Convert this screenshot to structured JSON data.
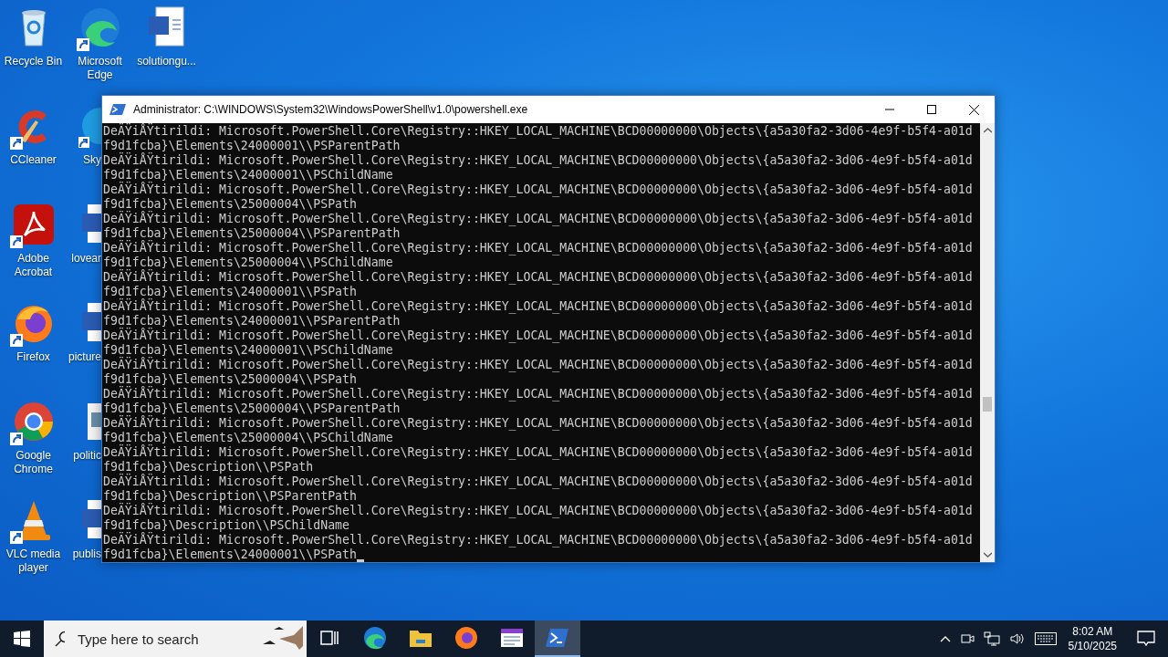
{
  "desktop": {
    "columns": [
      [
        {
          "label": "Recycle Bin",
          "shortcut": false
        },
        {
          "label": "CCleaner",
          "shortcut": true
        },
        {
          "label": "Adobe Acrobat",
          "shortcut": true
        },
        {
          "label": "Firefox",
          "shortcut": true
        },
        {
          "label": "Google Chrome",
          "shortcut": true
        },
        {
          "label": "VLC media player",
          "shortcut": true
        }
      ],
      [
        {
          "label": "Microsoft Edge",
          "shortcut": true
        },
        {
          "label": "Sky",
          "shortcut": true
        },
        {
          "label": "lovear",
          "shortcut": false
        },
        {
          "label": "picture",
          "shortcut": false
        },
        {
          "label": "politic",
          "shortcut": false
        },
        {
          "label": "publis",
          "shortcut": false
        }
      ],
      [
        {
          "label": "solutiongu...",
          "shortcut": false
        }
      ]
    ]
  },
  "window": {
    "title": "Administrator: C:\\WINDOWS\\System32\\WindowsPowerShell\\v1.0\\powershell.exe",
    "lines": [
      "DeÄŸiÅŸtirildi: Microsoft.PowerShell.Core\\Registry::HKEY_LOCAL_MACHINE\\BCD00000000\\Objects\\{a5a30fa2-3d06-4e9f-b5f4-a01d",
      "f9d1fcba}\\Elements\\24000001\\\\PSParentPath",
      "DeÄŸiÅŸtirildi: Microsoft.PowerShell.Core\\Registry::HKEY_LOCAL_MACHINE\\BCD00000000\\Objects\\{a5a30fa2-3d06-4e9f-b5f4-a01d",
      "f9d1fcba}\\Elements\\24000001\\\\PSChildName",
      "DeÄŸiÅŸtirildi: Microsoft.PowerShell.Core\\Registry::HKEY_LOCAL_MACHINE\\BCD00000000\\Objects\\{a5a30fa2-3d06-4e9f-b5f4-a01d",
      "f9d1fcba}\\Elements\\25000004\\\\PSPath",
      "DeÄŸiÅŸtirildi: Microsoft.PowerShell.Core\\Registry::HKEY_LOCAL_MACHINE\\BCD00000000\\Objects\\{a5a30fa2-3d06-4e9f-b5f4-a01d",
      "f9d1fcba}\\Elements\\25000004\\\\PSParentPath",
      "DeÄŸiÅŸtirildi: Microsoft.PowerShell.Core\\Registry::HKEY_LOCAL_MACHINE\\BCD00000000\\Objects\\{a5a30fa2-3d06-4e9f-b5f4-a01d",
      "f9d1fcba}\\Elements\\25000004\\\\PSChildName",
      "DeÄŸiÅŸtirildi: Microsoft.PowerShell.Core\\Registry::HKEY_LOCAL_MACHINE\\BCD00000000\\Objects\\{a5a30fa2-3d06-4e9f-b5f4-a01d",
      "f9d1fcba}\\Elements\\24000001\\\\PSPath",
      "DeÄŸiÅŸtirildi: Microsoft.PowerShell.Core\\Registry::HKEY_LOCAL_MACHINE\\BCD00000000\\Objects\\{a5a30fa2-3d06-4e9f-b5f4-a01d",
      "f9d1fcba}\\Elements\\24000001\\\\PSParentPath",
      "DeÄŸiÅŸtirildi: Microsoft.PowerShell.Core\\Registry::HKEY_LOCAL_MACHINE\\BCD00000000\\Objects\\{a5a30fa2-3d06-4e9f-b5f4-a01d",
      "f9d1fcba}\\Elements\\24000001\\\\PSChildName",
      "DeÄŸiÅŸtirildi: Microsoft.PowerShell.Core\\Registry::HKEY_LOCAL_MACHINE\\BCD00000000\\Objects\\{a5a30fa2-3d06-4e9f-b5f4-a01d",
      "f9d1fcba}\\Elements\\25000004\\\\PSPath",
      "DeÄŸiÅŸtirildi: Microsoft.PowerShell.Core\\Registry::HKEY_LOCAL_MACHINE\\BCD00000000\\Objects\\{a5a30fa2-3d06-4e9f-b5f4-a01d",
      "f9d1fcba}\\Elements\\25000004\\\\PSParentPath",
      "DeÄŸiÅŸtirildi: Microsoft.PowerShell.Core\\Registry::HKEY_LOCAL_MACHINE\\BCD00000000\\Objects\\{a5a30fa2-3d06-4e9f-b5f4-a01d",
      "f9d1fcba}\\Elements\\25000004\\\\PSChildName",
      "DeÄŸiÅŸtirildi: Microsoft.PowerShell.Core\\Registry::HKEY_LOCAL_MACHINE\\BCD00000000\\Objects\\{a5a30fa2-3d06-4e9f-b5f4-a01d",
      "f9d1fcba}\\Description\\\\PSPath",
      "DeÄŸiÅŸtirildi: Microsoft.PowerShell.Core\\Registry::HKEY_LOCAL_MACHINE\\BCD00000000\\Objects\\{a5a30fa2-3d06-4e9f-b5f4-a01d",
      "f9d1fcba}\\Description\\\\PSParentPath",
      "DeÄŸiÅŸtirildi: Microsoft.PowerShell.Core\\Registry::HKEY_LOCAL_MACHINE\\BCD00000000\\Objects\\{a5a30fa2-3d06-4e9f-b5f4-a01d",
      "f9d1fcba}\\Description\\\\PSChildName",
      "DeÄŸiÅŸtirildi: Microsoft.PowerShell.Core\\Registry::HKEY_LOCAL_MACHINE\\BCD00000000\\Objects\\{a5a30fa2-3d06-4e9f-b5f4-a01d",
      "f9d1fcba}\\Elements\\24000001\\\\PSPath"
    ]
  },
  "taskbar": {
    "search": {
      "placeholder": "Type here to search"
    },
    "apps": [
      {
        "active": false
      },
      {
        "active": false
      },
      {
        "active": false
      },
      {
        "active": false
      },
      {
        "active": false
      },
      {
        "active": true
      }
    ],
    "time": "8:02 AM",
    "date": "5/10/2025"
  }
}
